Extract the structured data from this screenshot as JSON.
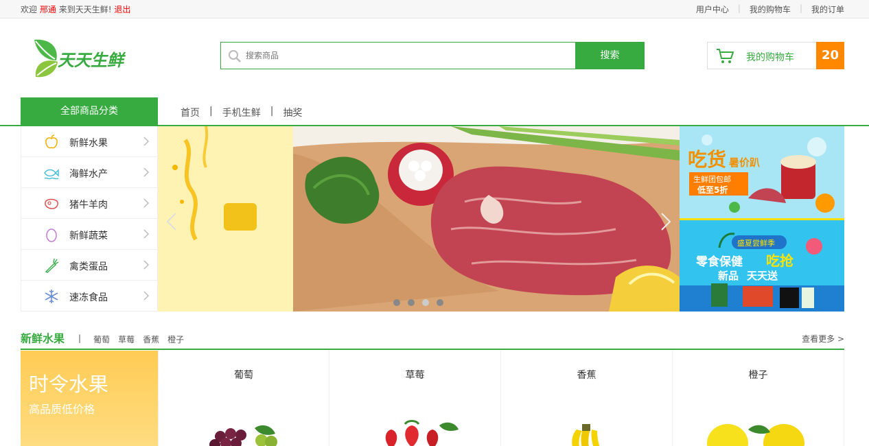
{
  "topbar": {
    "welcome_prefix": "欢迎",
    "username": "邢通",
    "welcome_suffix": "来到天天生鲜!",
    "logout": "退出",
    "links": [
      "用户中心",
      "我的购物车",
      "我的订单"
    ]
  },
  "logo": {
    "brand": "天天生鲜"
  },
  "search": {
    "placeholder": "搜索商品",
    "button": "搜索"
  },
  "cart": {
    "label": "我的购物车",
    "count": "20"
  },
  "nav": {
    "all_categories": "全部商品分类",
    "links": [
      "首页",
      "手机生鲜",
      "抽奖"
    ],
    "separator": "|"
  },
  "categories": [
    {
      "label": "新鲜水果",
      "icon": "apple-icon"
    },
    {
      "label": "海鲜水产",
      "icon": "seafood-icon"
    },
    {
      "label": "猪牛羊肉",
      "icon": "meat-icon"
    },
    {
      "label": "新鲜蔬菜",
      "icon": "egg-icon"
    },
    {
      "label": "禽类蛋品",
      "icon": "carrot-icon"
    },
    {
      "label": "速冻食品",
      "icon": "snowflake-icon"
    }
  ],
  "banner": {
    "active_dot": 1
  },
  "side_ads": {
    "ad1": {
      "title": "吃货",
      "subtitle": "暑价趴",
      "text1": "生鲜团包邮",
      "text2": "低至5折"
    },
    "ad2": {
      "title": "盛夏尝鲜季",
      "text1": "零食保健",
      "text2": "新品",
      "text3": "吃抢",
      "text4": "天天送"
    }
  },
  "section": {
    "title": "新鲜水果",
    "separator": "|",
    "sublinks": [
      "葡萄",
      "草莓",
      "香蕉",
      "橙子"
    ],
    "more": "查看更多 >"
  },
  "promo": {
    "title": "时令水果",
    "subtitle": "高品质低价格"
  },
  "products": [
    {
      "name": "葡萄"
    },
    {
      "name": "草莓"
    },
    {
      "name": "香蕉"
    },
    {
      "name": "橙子"
    }
  ],
  "colors": {
    "brand_green": "#37ab40",
    "orange": "#ff8800",
    "red": "#ff0000"
  }
}
